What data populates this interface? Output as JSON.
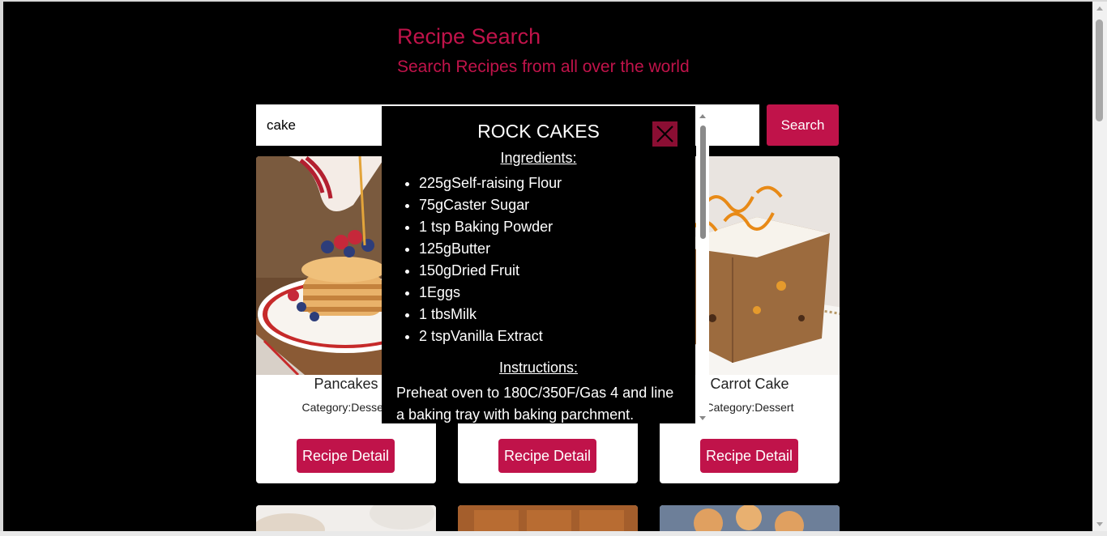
{
  "header": {
    "title": "Recipe Search",
    "subtitle": "Search Recipes from all over the world"
  },
  "search": {
    "value": "cake",
    "button_label": "Search"
  },
  "cards": [
    {
      "name": "Pancakes",
      "category_label": "Category:",
      "category": "Dessert",
      "button_label": "Recipe Detail"
    },
    {
      "name": "",
      "category_label": "",
      "category": "",
      "button_label": "Recipe Detail"
    },
    {
      "name": "Carrot Cake",
      "category_label": "Category:",
      "category": "Dessert",
      "button_label": "Recipe Detail"
    }
  ],
  "modal": {
    "title": "ROCK CAKES",
    "ingredients_heading": "Ingredients:",
    "ingredients": [
      "225gSelf-raising Flour",
      "75gCaster Sugar",
      "1 tsp Baking Powder",
      "125gButter",
      "150gDried Fruit",
      "1Eggs",
      "1 tbsMilk",
      "2 tspVanilla Extract"
    ],
    "instructions_heading": "Instructions:",
    "instructions_text": "Preheat oven to 180C/350F/Gas 4 and line a baking tray with baking parchment."
  },
  "colors": {
    "accent": "#c0134a",
    "background": "#000000",
    "close_button": "#8a0e33"
  }
}
